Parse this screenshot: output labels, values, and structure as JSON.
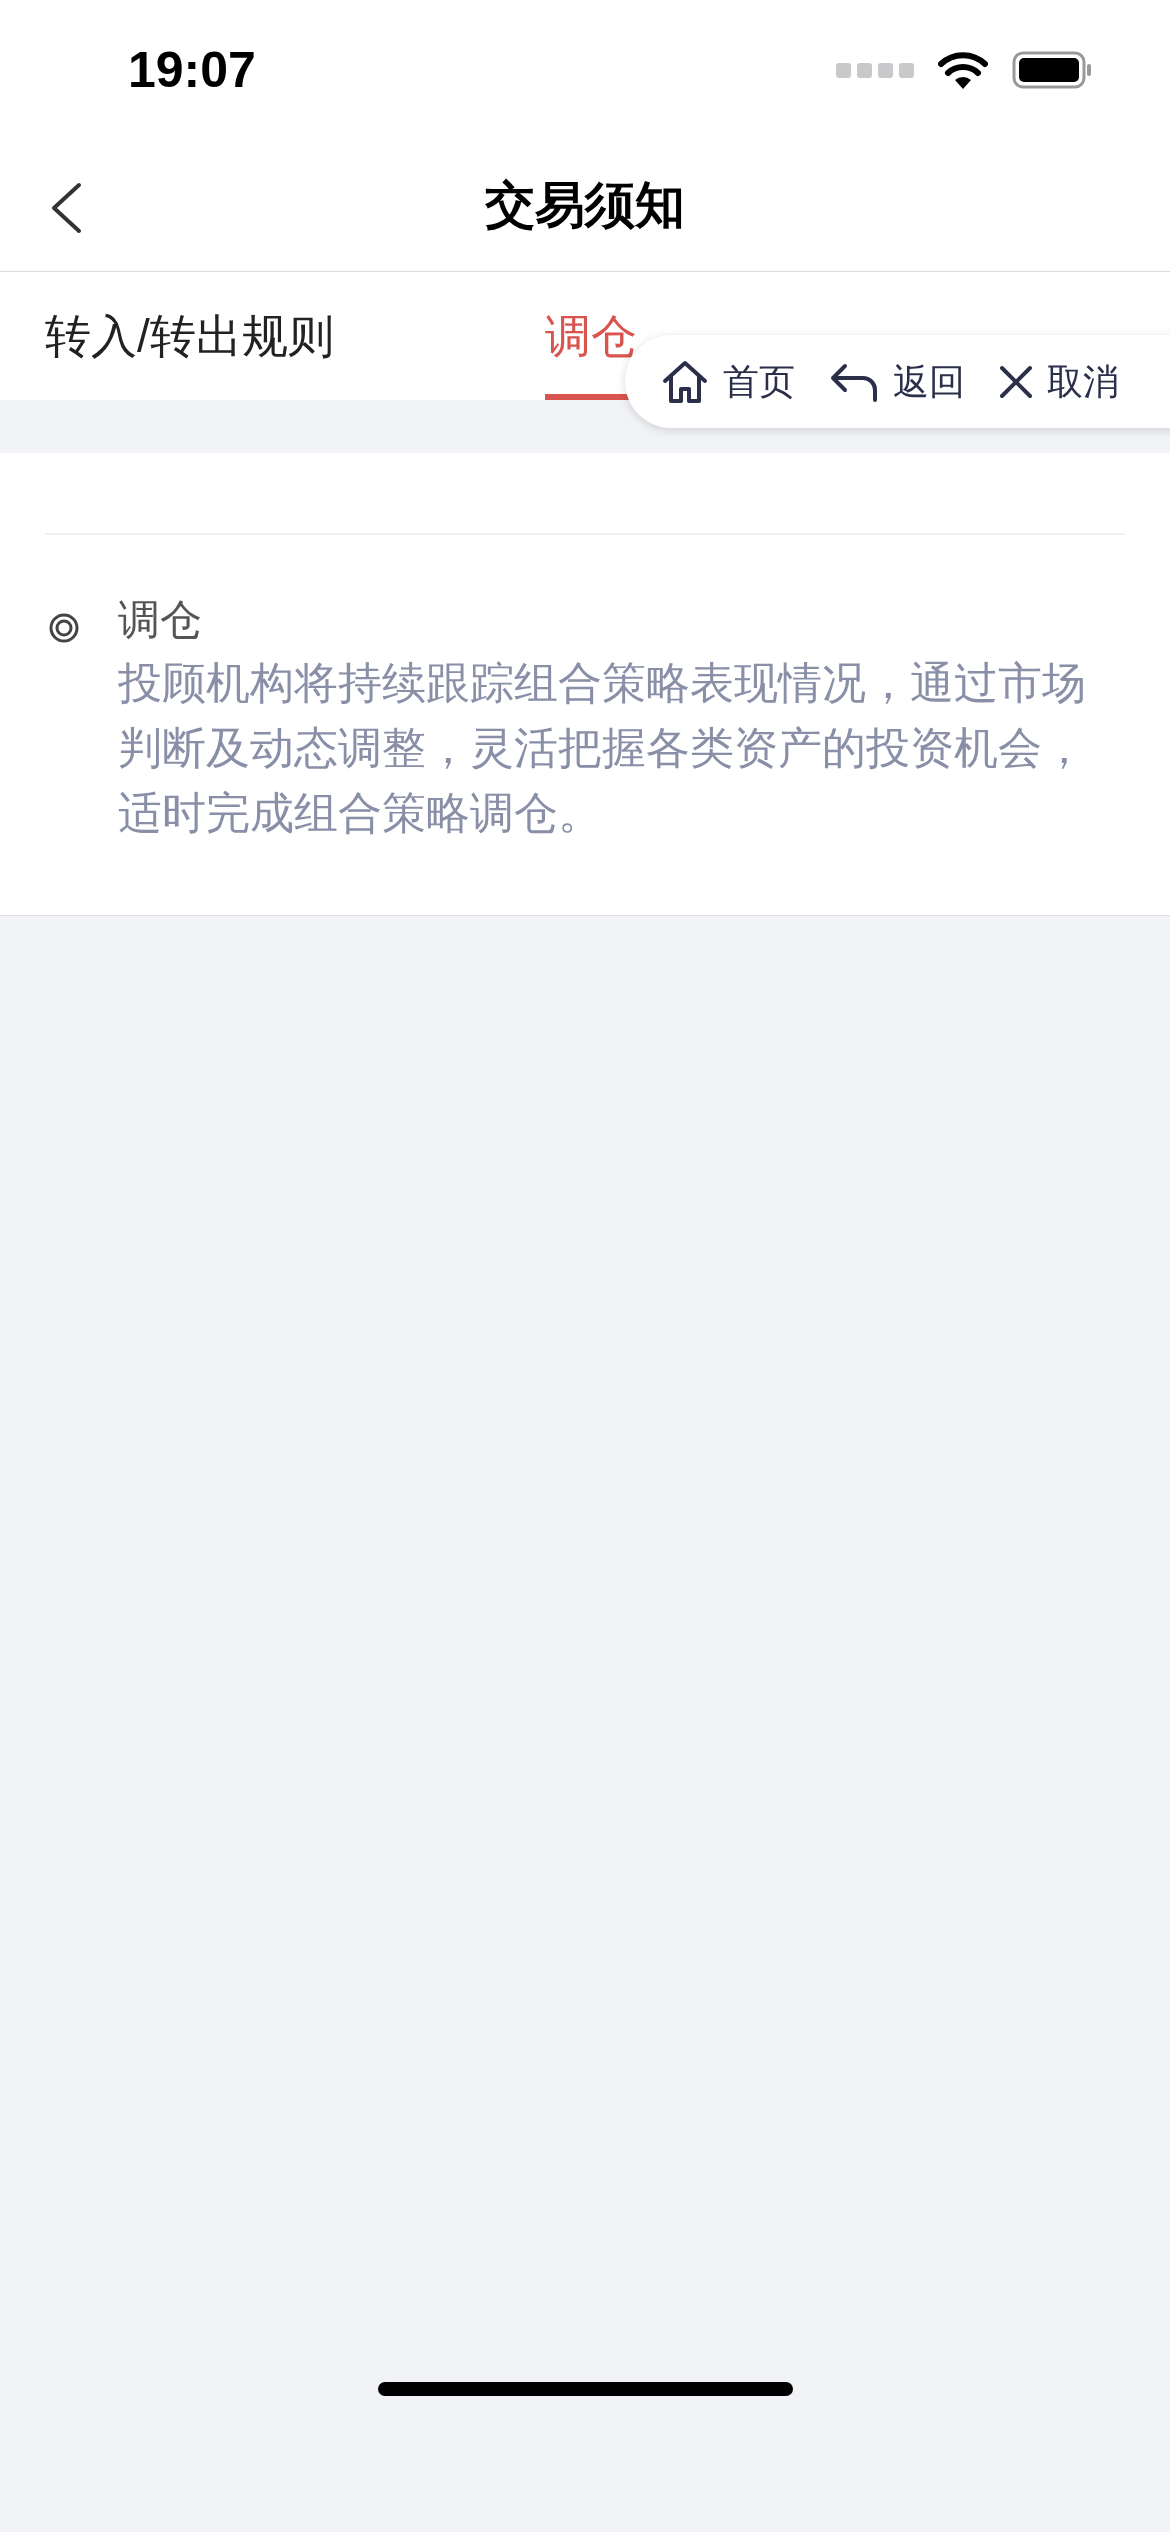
{
  "status_bar": {
    "time": "19:07"
  },
  "nav": {
    "title": "交易须知"
  },
  "tabs": [
    {
      "label": "转入/转出规则",
      "selected": false
    },
    {
      "label": "调仓",
      "selected": true
    }
  ],
  "section": {
    "heading": "调仓",
    "body": "投顾机构将持续跟踪组合策略表现情况，通过市场判断及动态调整，灵活把握各类资产的投资机会，适时完成组合策略调仓。"
  },
  "quick_menu": [
    {
      "kind": "home",
      "label": "首页"
    },
    {
      "kind": "back",
      "label": "返回"
    },
    {
      "kind": "cancel",
      "label": "取消"
    }
  ]
}
